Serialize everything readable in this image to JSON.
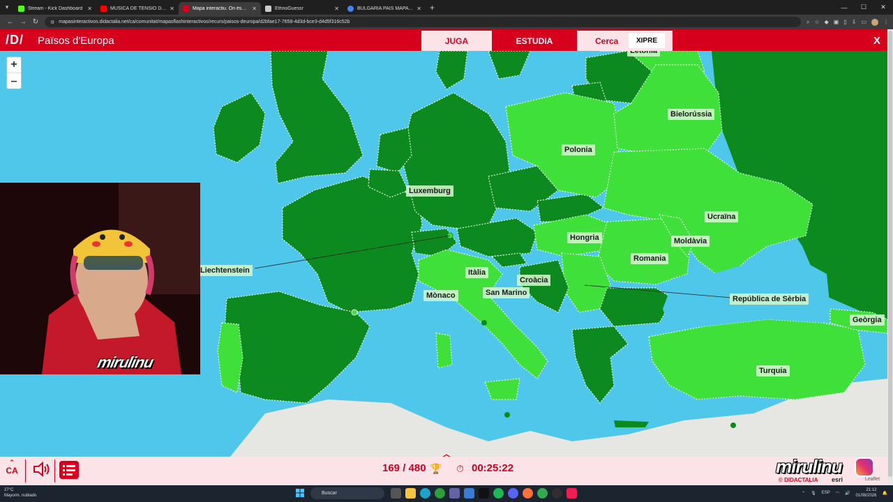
{
  "browser": {
    "tabs": [
      {
        "title": "Stream - Kick Dashboard",
        "favicon_color": "#53fc18",
        "active": false
      },
      {
        "title": "MÚSICA DE TENSIÓ D''EL...",
        "favicon_color": "#ff0000",
        "active": false
      },
      {
        "title": "Mapa interactiu. On és? Països...",
        "favicon_color": "#d6001c",
        "active": true
      },
      {
        "title": "EthnoGuessr",
        "favicon_color": "#cccccc",
        "active": false
      },
      {
        "title": "BULGARIA PAIS MAPA - Cerca ...",
        "favicon_color": "#4285f4",
        "active": false
      }
    ],
    "url": "mapasinteractivos.didactalia.net/ca/comunitat/mapasflashinteractivos/recurs/paisos-deuropa/d2bfae17-7658-4d3d-bce3-d4d5f316c52b"
  },
  "app": {
    "logo": "/D/",
    "title": "Països d'Europa",
    "modes": {
      "play": "JUGA",
      "study": "ESTUDIA",
      "search": "Cerca"
    },
    "search_value": "XIPRE",
    "close": "X"
  },
  "map": {
    "zoom_in": "+",
    "zoom_out": "–",
    "labels": {
      "letonia": "Letònia",
      "bielorussia": "Bielorússia",
      "polonia": "Polonia",
      "luxemburg": "Luxemburg",
      "ucraina": "Ucraïna",
      "hongria": "Hongria",
      "moldavia": "Moldàvia",
      "romania": "Romania",
      "liechtenstein": "Liechtenstein",
      "italia": "Itàlia",
      "croacia": "Croàcia",
      "monaco": "Mònaco",
      "san_marino": "San Marino",
      "serbia": "República de Sèrbia",
      "georgia": "Geòrgia",
      "turquia": "Turquia"
    },
    "colors": {
      "sea": "#4ec7ea",
      "guessed": "#0d8a1f",
      "pending": "#3fe03a",
      "land": "#e6e6e2"
    }
  },
  "streamer": {
    "overlay_name": "mirulinu"
  },
  "footer": {
    "language": "CA",
    "score": "169 / 480",
    "timer": "00:25:22"
  },
  "branding": {
    "channel": "mirulinu",
    "didactalia": "© DIDACTALIA",
    "esri": "esri",
    "leaflet": "Leaflet"
  },
  "taskbar": {
    "weather_temp": "27°C",
    "weather_desc": "Mayorm. nublado",
    "search_placeholder": "Buscar",
    "lang": "ESP",
    "time": "21:12",
    "date": "01/08/2026"
  }
}
